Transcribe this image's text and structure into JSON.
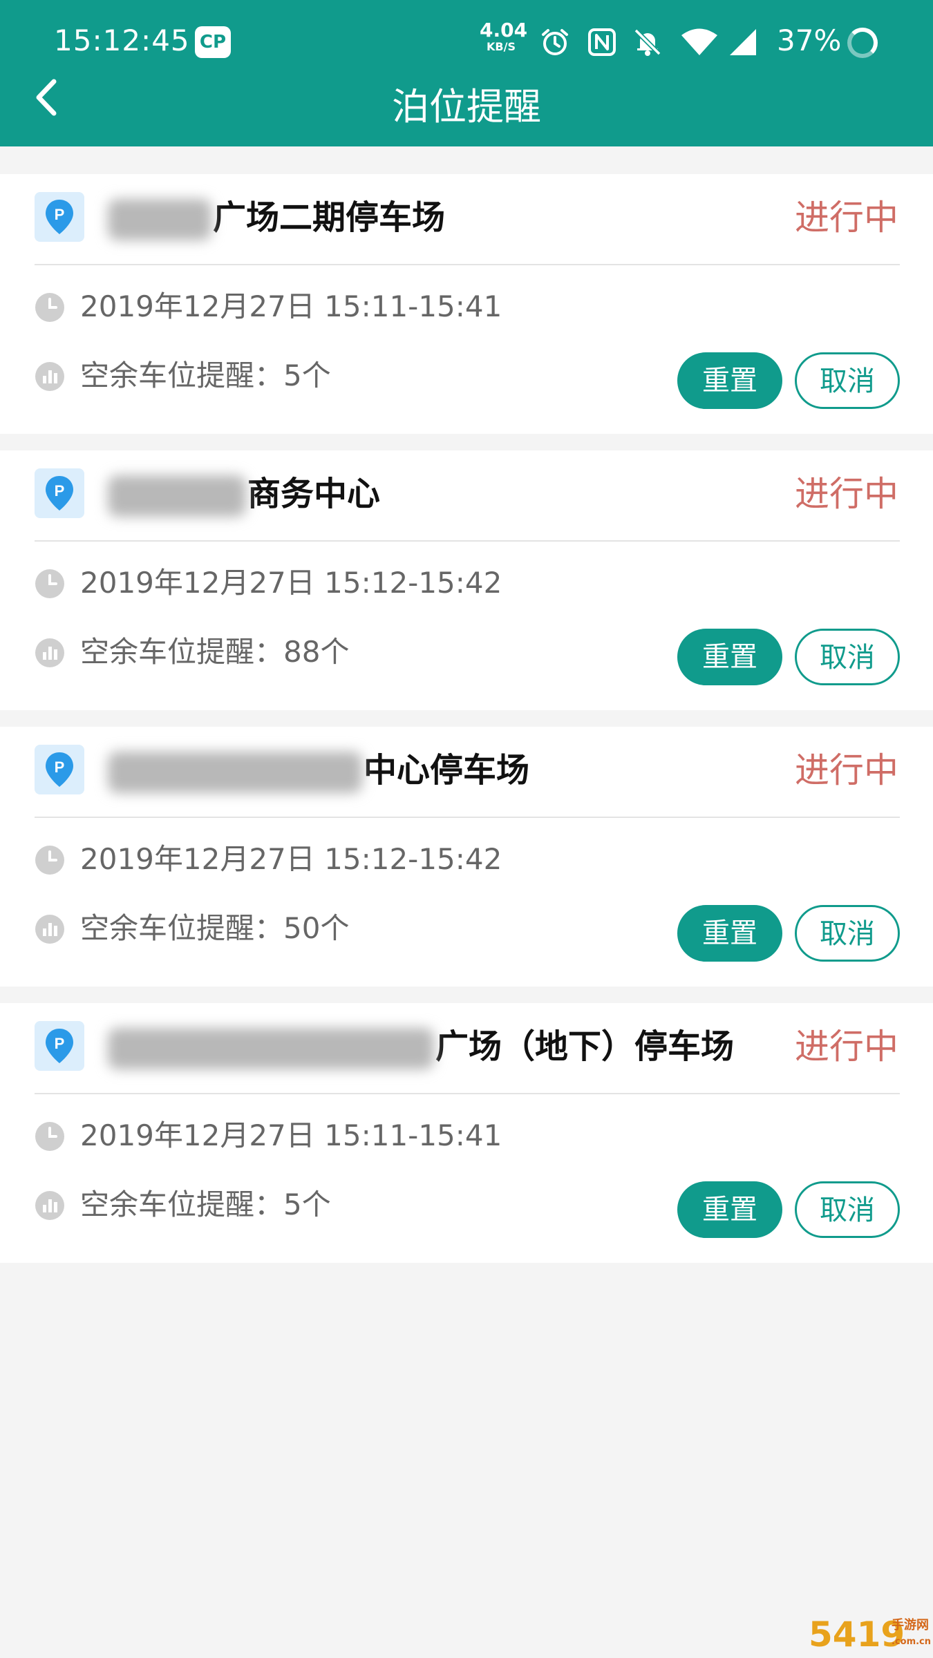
{
  "status_bar": {
    "time": "15:12:45",
    "app_badge": "CP",
    "net_speed_value": "4.04",
    "net_speed_unit": "KB/S",
    "battery": "37%"
  },
  "header": {
    "title": "泊位提醒",
    "back_icon": "chevron-left-icon"
  },
  "labels": {
    "status": "进行中",
    "spots_prefix": "空余车位提醒：",
    "reset": "重置",
    "cancel": "取消"
  },
  "reminders": [
    {
      "name_visible": "广场二期停车场",
      "status": "进行中",
      "date_time": "2019年12月27日  15:11-15:41",
      "spots": "空余车位提醒：5个",
      "reset": "重置",
      "cancel": "取消"
    },
    {
      "name_visible": "商务中心",
      "status": "进行中",
      "date_time": "2019年12月27日  15:12-15:42",
      "spots": "空余车位提醒：88个",
      "reset": "重置",
      "cancel": "取消"
    },
    {
      "name_visible": "中心停车场",
      "status": "进行中",
      "date_time": "2019年12月27日  15:12-15:42",
      "spots": "空余车位提醒：50个",
      "reset": "重置",
      "cancel": "取消"
    },
    {
      "name_visible": "广场（地下）停车场",
      "status": "进行中",
      "date_time": "2019年12月27日  15:11-15:41",
      "spots": "空余车位提醒：5个",
      "reset": "重置",
      "cancel": "取消"
    }
  ],
  "colors": {
    "brand": "#109b8c",
    "status_text": "#cf6d66",
    "badge_bg": "#dceefc",
    "badge_pin": "#2b9ae8"
  },
  "watermark": {
    "number": "5419",
    "text": "手游网",
    "domain": ".com.cn"
  }
}
